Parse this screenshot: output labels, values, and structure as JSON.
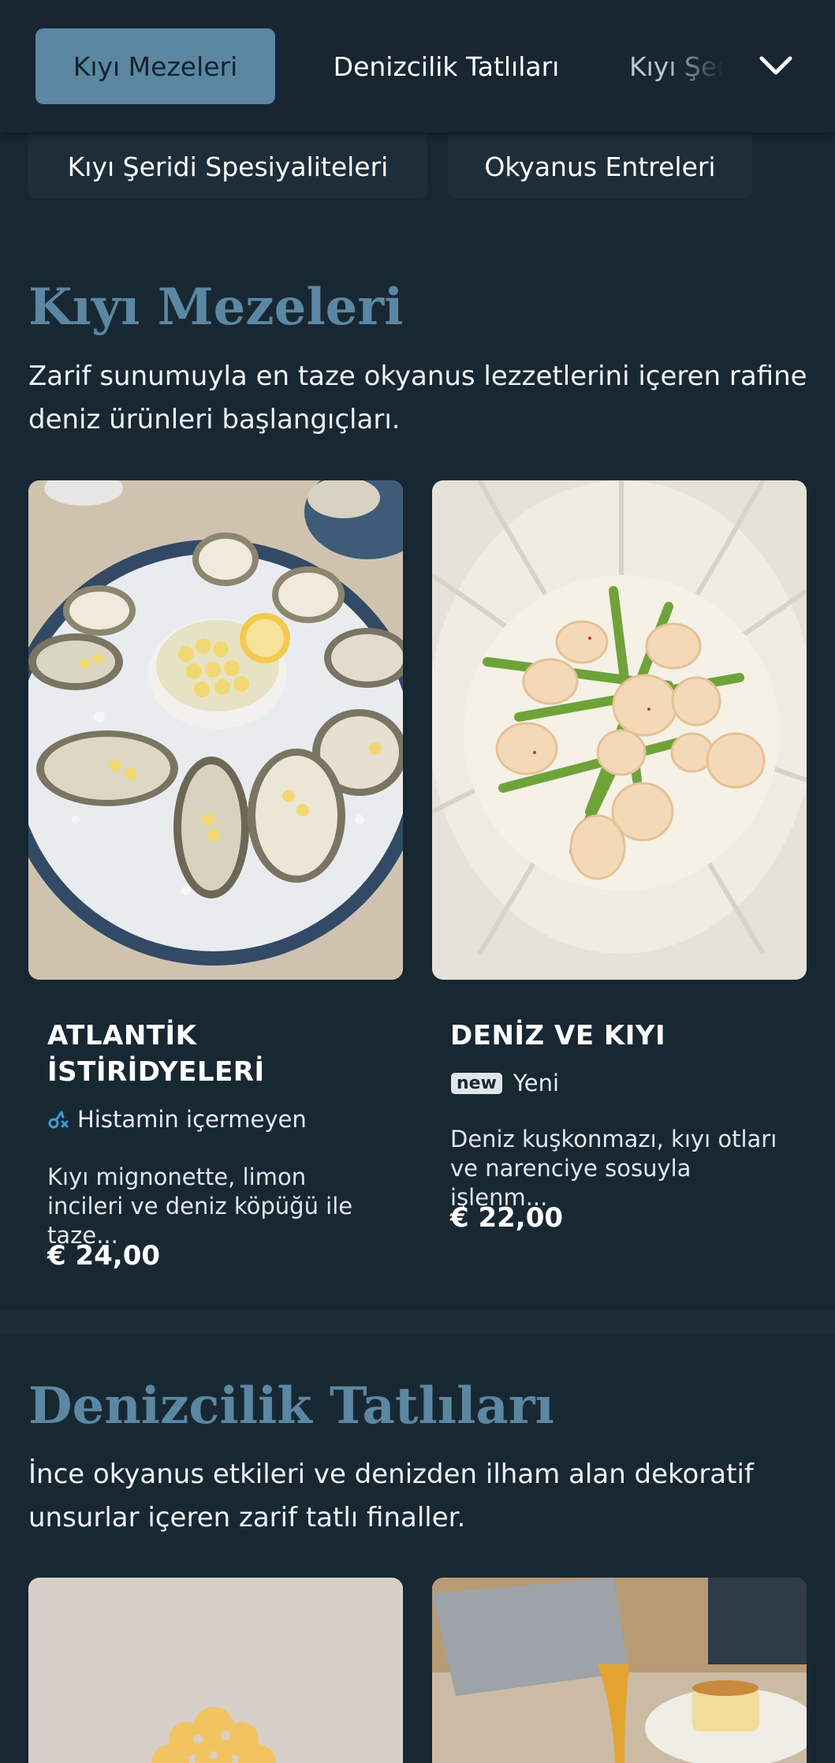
{
  "nav": {
    "tabs": [
      "Kıyı Mezeleri",
      "Denizcilik Tatlıları",
      "Kıyı Şeridi Spesiyaliteleri"
    ],
    "active_tab": "Kıyı Mezeleri",
    "more_icon": "chevron-down-icon"
  },
  "sub_tabs": [
    "Kıyı Şeridi Spesiyaliteleri",
    "Okyanus Entreleri"
  ],
  "sections": [
    {
      "title": "Kıyı Mezeleri",
      "description": "Zarif sunumuyla en taze okyanus lezzetlerini içeren rafine deniz ürünleri başlangıçları.",
      "items": [
        {
          "name": "ATLANTİK İSTİRİDYELERİ",
          "badge": "Histamin içermeyen",
          "badge_icon": "histamine-free-icon",
          "description": "Kıyı mignonette, limon incileri ve deniz köpüğü ile taze...",
          "price": "€ 24,00"
        },
        {
          "name": "DENİZ VE KIYI",
          "badge_tag": "new",
          "badge": "Yeni",
          "description": "Deniz kuşkonmazı, kıyı otları ve narenciye sosuyla işlenm...",
          "price": "€ 22,00"
        }
      ]
    },
    {
      "title": "Denizcilik Tatlıları",
      "description": "İnce okyanus etkileri ve denizden ilham alan dekoratif unsurlar içeren zarif tatlı finaller."
    }
  ],
  "colors": {
    "background": "#182833",
    "accent": "#5b87a2",
    "nav_background": "#172631"
  }
}
